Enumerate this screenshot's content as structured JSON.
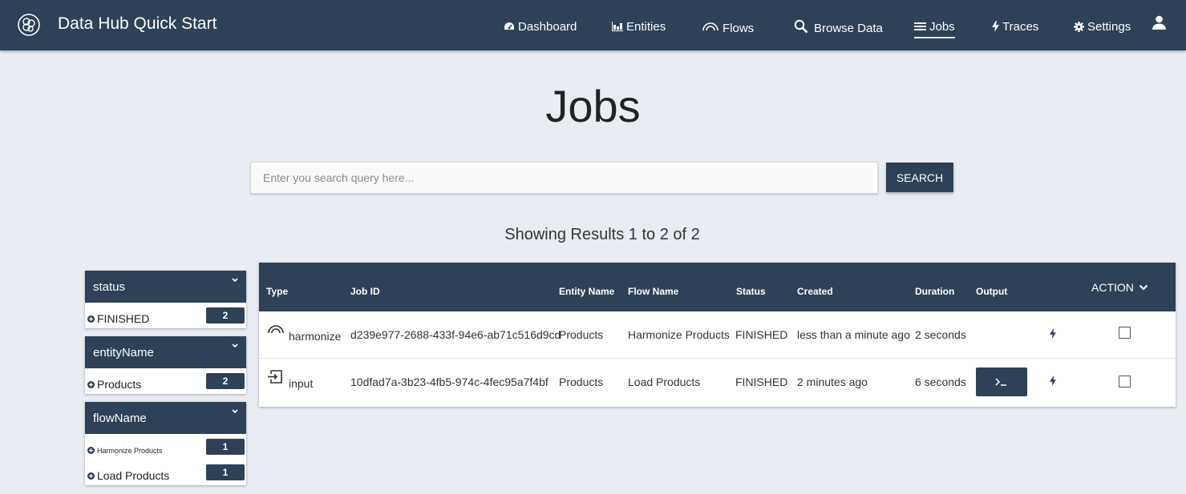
{
  "header": {
    "app_title": "Data Hub Quick Start",
    "nav": [
      {
        "label": "Dashboard",
        "icon": "dashboard-icon"
      },
      {
        "label": "Entities",
        "icon": "entities-icon"
      },
      {
        "label": "Flows",
        "icon": "flows-icon"
      },
      {
        "label": "Browse Data",
        "icon": "search-icon"
      },
      {
        "label": "Jobs",
        "icon": "jobs-icon",
        "active": true
      },
      {
        "label": "Traces",
        "icon": "bolt-icon"
      },
      {
        "label": "Settings",
        "icon": "gear-icon"
      }
    ],
    "user_icon": "user-icon"
  },
  "page": {
    "title": "Jobs",
    "search": {
      "placeholder": "Enter you search query here...",
      "value": "",
      "button_label": "SEARCH"
    },
    "results_text": "Showing Results 1 to 2 of 2"
  },
  "facets": [
    {
      "name": "status",
      "items": [
        {
          "label": "FINISHED",
          "count": "2"
        }
      ]
    },
    {
      "name": "entityName",
      "items": [
        {
          "label": "Products",
          "count": "2"
        }
      ]
    },
    {
      "name": "flowName",
      "items": [
        {
          "label": "Harmonize Products",
          "count": "1"
        },
        {
          "label": "Load Products",
          "count": "1"
        }
      ]
    }
  ],
  "table": {
    "columns": [
      "Type",
      "Job ID",
      "Entity Name",
      "Flow Name",
      "Status",
      "Created",
      "Duration",
      "Output"
    ],
    "action_label": "ACTION",
    "rows": [
      {
        "type": "harmonize",
        "job_id": "d239e977-2688-433f-94e6-ab71c516d9cd",
        "entity": "Products",
        "flow": "Harmonize Products",
        "status": "FINISHED",
        "created": "less than a minute ago",
        "duration": "2 seconds",
        "output": "",
        "checked": false
      },
      {
        "type": "input",
        "job_id": "10dfad7a-3b23-4fb5-974c-4fec95a7f4bf",
        "entity": "Products",
        "flow": "Load Products",
        "status": "FINISHED",
        "created": "2 minutes ago",
        "duration": "6 seconds",
        "output": "terminal-icon",
        "checked": false
      }
    ]
  },
  "colors": {
    "primary": "#2e4156",
    "background": "#e9ecf2"
  }
}
